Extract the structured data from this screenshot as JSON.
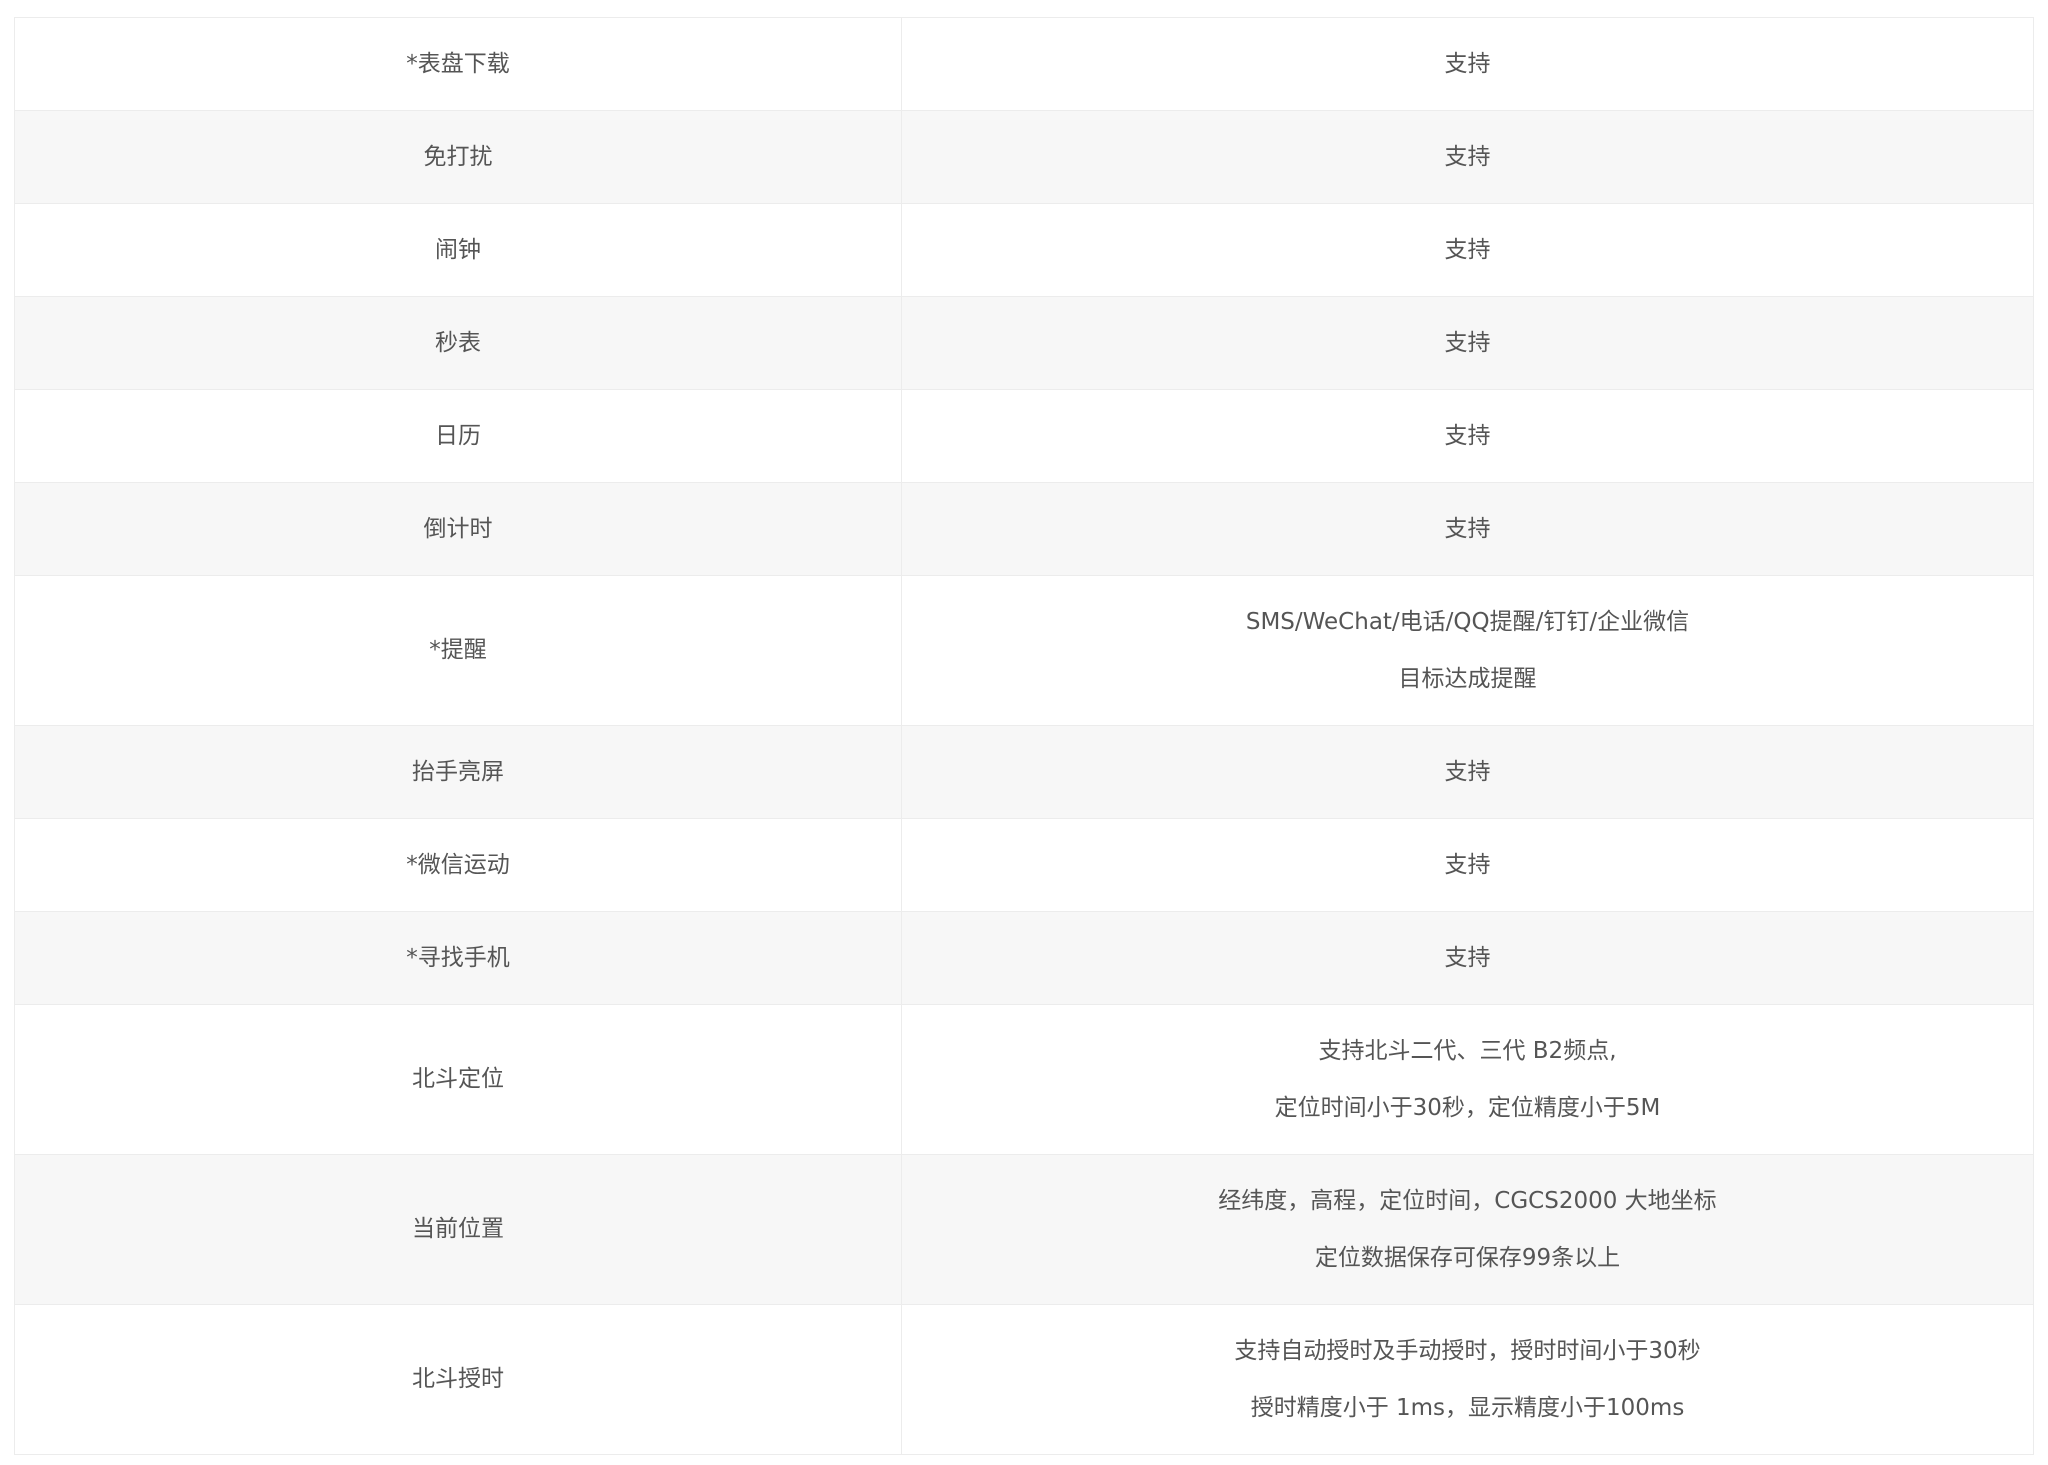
{
  "rows": [
    {
      "feature": "*表盘下载",
      "lines": [
        "支持"
      ]
    },
    {
      "feature": "免打扰",
      "lines": [
        "支持"
      ]
    },
    {
      "feature": "闹钟",
      "lines": [
        "支持"
      ]
    },
    {
      "feature": "秒表",
      "lines": [
        "支持"
      ]
    },
    {
      "feature": "日历",
      "lines": [
        "支持"
      ]
    },
    {
      "feature": "倒计时",
      "lines": [
        "支持"
      ]
    },
    {
      "feature": "*提醒",
      "lines": [
        "SMS/WeChat/电话/QQ提醒/钉钉/企业微信",
        "目标达成提醒"
      ]
    },
    {
      "feature": "抬手亮屏",
      "lines": [
        "支持"
      ]
    },
    {
      "feature": "*微信运动",
      "lines": [
        "支持"
      ]
    },
    {
      "feature": "*寻找手机",
      "lines": [
        "支持"
      ]
    },
    {
      "feature": "北斗定位",
      "lines": [
        "支持北斗二代、三代 B2频点,",
        "定位时间小于30秒，定位精度小于5M"
      ]
    },
    {
      "feature": "当前位置",
      "lines": [
        "经纬度，高程，定位时间，CGCS2000 大地坐标",
        "定位数据保存可保存99条以上"
      ]
    },
    {
      "feature": "北斗授时",
      "lines": [
        "支持自动授时及手动授时，授时时间小于30秒",
        "授时精度小于 1ms，显示精度小于100ms"
      ]
    }
  ]
}
